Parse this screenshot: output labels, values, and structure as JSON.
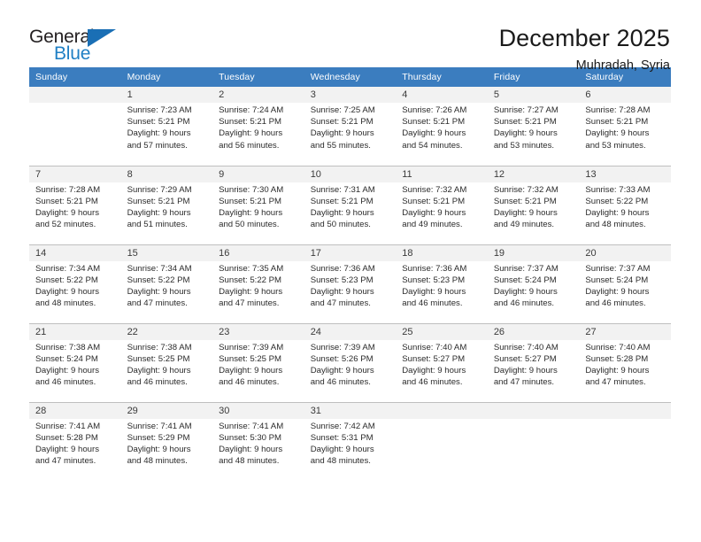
{
  "brand": {
    "name_part1": "General",
    "name_part2": "Blue",
    "accent_color": "#1a6fb5"
  },
  "header": {
    "title": "December 2025",
    "subtitle": "Muhradah, Syria"
  },
  "calendar": {
    "header_color": "#3b7dbf",
    "daynum_band_color": "#f2f2f2",
    "weekday_headers": [
      "Sunday",
      "Monday",
      "Tuesday",
      "Wednesday",
      "Thursday",
      "Friday",
      "Saturday"
    ],
    "weeks": [
      [
        {
          "day": "",
          "sunrise": "",
          "sunset": "",
          "daylight1": "",
          "daylight2": ""
        },
        {
          "day": "1",
          "sunrise": "Sunrise: 7:23 AM",
          "sunset": "Sunset: 5:21 PM",
          "daylight1": "Daylight: 9 hours",
          "daylight2": "and 57 minutes."
        },
        {
          "day": "2",
          "sunrise": "Sunrise: 7:24 AM",
          "sunset": "Sunset: 5:21 PM",
          "daylight1": "Daylight: 9 hours",
          "daylight2": "and 56 minutes."
        },
        {
          "day": "3",
          "sunrise": "Sunrise: 7:25 AM",
          "sunset": "Sunset: 5:21 PM",
          "daylight1": "Daylight: 9 hours",
          "daylight2": "and 55 minutes."
        },
        {
          "day": "4",
          "sunrise": "Sunrise: 7:26 AM",
          "sunset": "Sunset: 5:21 PM",
          "daylight1": "Daylight: 9 hours",
          "daylight2": "and 54 minutes."
        },
        {
          "day": "5",
          "sunrise": "Sunrise: 7:27 AM",
          "sunset": "Sunset: 5:21 PM",
          "daylight1": "Daylight: 9 hours",
          "daylight2": "and 53 minutes."
        },
        {
          "day": "6",
          "sunrise": "Sunrise: 7:28 AM",
          "sunset": "Sunset: 5:21 PM",
          "daylight1": "Daylight: 9 hours",
          "daylight2": "and 53 minutes."
        }
      ],
      [
        {
          "day": "7",
          "sunrise": "Sunrise: 7:28 AM",
          "sunset": "Sunset: 5:21 PM",
          "daylight1": "Daylight: 9 hours",
          "daylight2": "and 52 minutes."
        },
        {
          "day": "8",
          "sunrise": "Sunrise: 7:29 AM",
          "sunset": "Sunset: 5:21 PM",
          "daylight1": "Daylight: 9 hours",
          "daylight2": "and 51 minutes."
        },
        {
          "day": "9",
          "sunrise": "Sunrise: 7:30 AM",
          "sunset": "Sunset: 5:21 PM",
          "daylight1": "Daylight: 9 hours",
          "daylight2": "and 50 minutes."
        },
        {
          "day": "10",
          "sunrise": "Sunrise: 7:31 AM",
          "sunset": "Sunset: 5:21 PM",
          "daylight1": "Daylight: 9 hours",
          "daylight2": "and 50 minutes."
        },
        {
          "day": "11",
          "sunrise": "Sunrise: 7:32 AM",
          "sunset": "Sunset: 5:21 PM",
          "daylight1": "Daylight: 9 hours",
          "daylight2": "and 49 minutes."
        },
        {
          "day": "12",
          "sunrise": "Sunrise: 7:32 AM",
          "sunset": "Sunset: 5:21 PM",
          "daylight1": "Daylight: 9 hours",
          "daylight2": "and 49 minutes."
        },
        {
          "day": "13",
          "sunrise": "Sunrise: 7:33 AM",
          "sunset": "Sunset: 5:22 PM",
          "daylight1": "Daylight: 9 hours",
          "daylight2": "and 48 minutes."
        }
      ],
      [
        {
          "day": "14",
          "sunrise": "Sunrise: 7:34 AM",
          "sunset": "Sunset: 5:22 PM",
          "daylight1": "Daylight: 9 hours",
          "daylight2": "and 48 minutes."
        },
        {
          "day": "15",
          "sunrise": "Sunrise: 7:34 AM",
          "sunset": "Sunset: 5:22 PM",
          "daylight1": "Daylight: 9 hours",
          "daylight2": "and 47 minutes."
        },
        {
          "day": "16",
          "sunrise": "Sunrise: 7:35 AM",
          "sunset": "Sunset: 5:22 PM",
          "daylight1": "Daylight: 9 hours",
          "daylight2": "and 47 minutes."
        },
        {
          "day": "17",
          "sunrise": "Sunrise: 7:36 AM",
          "sunset": "Sunset: 5:23 PM",
          "daylight1": "Daylight: 9 hours",
          "daylight2": "and 47 minutes."
        },
        {
          "day": "18",
          "sunrise": "Sunrise: 7:36 AM",
          "sunset": "Sunset: 5:23 PM",
          "daylight1": "Daylight: 9 hours",
          "daylight2": "and 46 minutes."
        },
        {
          "day": "19",
          "sunrise": "Sunrise: 7:37 AM",
          "sunset": "Sunset: 5:24 PM",
          "daylight1": "Daylight: 9 hours",
          "daylight2": "and 46 minutes."
        },
        {
          "day": "20",
          "sunrise": "Sunrise: 7:37 AM",
          "sunset": "Sunset: 5:24 PM",
          "daylight1": "Daylight: 9 hours",
          "daylight2": "and 46 minutes."
        }
      ],
      [
        {
          "day": "21",
          "sunrise": "Sunrise: 7:38 AM",
          "sunset": "Sunset: 5:24 PM",
          "daylight1": "Daylight: 9 hours",
          "daylight2": "and 46 minutes."
        },
        {
          "day": "22",
          "sunrise": "Sunrise: 7:38 AM",
          "sunset": "Sunset: 5:25 PM",
          "daylight1": "Daylight: 9 hours",
          "daylight2": "and 46 minutes."
        },
        {
          "day": "23",
          "sunrise": "Sunrise: 7:39 AM",
          "sunset": "Sunset: 5:25 PM",
          "daylight1": "Daylight: 9 hours",
          "daylight2": "and 46 minutes."
        },
        {
          "day": "24",
          "sunrise": "Sunrise: 7:39 AM",
          "sunset": "Sunset: 5:26 PM",
          "daylight1": "Daylight: 9 hours",
          "daylight2": "and 46 minutes."
        },
        {
          "day": "25",
          "sunrise": "Sunrise: 7:40 AM",
          "sunset": "Sunset: 5:27 PM",
          "daylight1": "Daylight: 9 hours",
          "daylight2": "and 46 minutes."
        },
        {
          "day": "26",
          "sunrise": "Sunrise: 7:40 AM",
          "sunset": "Sunset: 5:27 PM",
          "daylight1": "Daylight: 9 hours",
          "daylight2": "and 47 minutes."
        },
        {
          "day": "27",
          "sunrise": "Sunrise: 7:40 AM",
          "sunset": "Sunset: 5:28 PM",
          "daylight1": "Daylight: 9 hours",
          "daylight2": "and 47 minutes."
        }
      ],
      [
        {
          "day": "28",
          "sunrise": "Sunrise: 7:41 AM",
          "sunset": "Sunset: 5:28 PM",
          "daylight1": "Daylight: 9 hours",
          "daylight2": "and 47 minutes."
        },
        {
          "day": "29",
          "sunrise": "Sunrise: 7:41 AM",
          "sunset": "Sunset: 5:29 PM",
          "daylight1": "Daylight: 9 hours",
          "daylight2": "and 48 minutes."
        },
        {
          "day": "30",
          "sunrise": "Sunrise: 7:41 AM",
          "sunset": "Sunset: 5:30 PM",
          "daylight1": "Daylight: 9 hours",
          "daylight2": "and 48 minutes."
        },
        {
          "day": "31",
          "sunrise": "Sunrise: 7:42 AM",
          "sunset": "Sunset: 5:31 PM",
          "daylight1": "Daylight: 9 hours",
          "daylight2": "and 48 minutes."
        },
        {
          "day": "",
          "sunrise": "",
          "sunset": "",
          "daylight1": "",
          "daylight2": ""
        },
        {
          "day": "",
          "sunrise": "",
          "sunset": "",
          "daylight1": "",
          "daylight2": ""
        },
        {
          "day": "",
          "sunrise": "",
          "sunset": "",
          "daylight1": "",
          "daylight2": ""
        }
      ]
    ]
  }
}
